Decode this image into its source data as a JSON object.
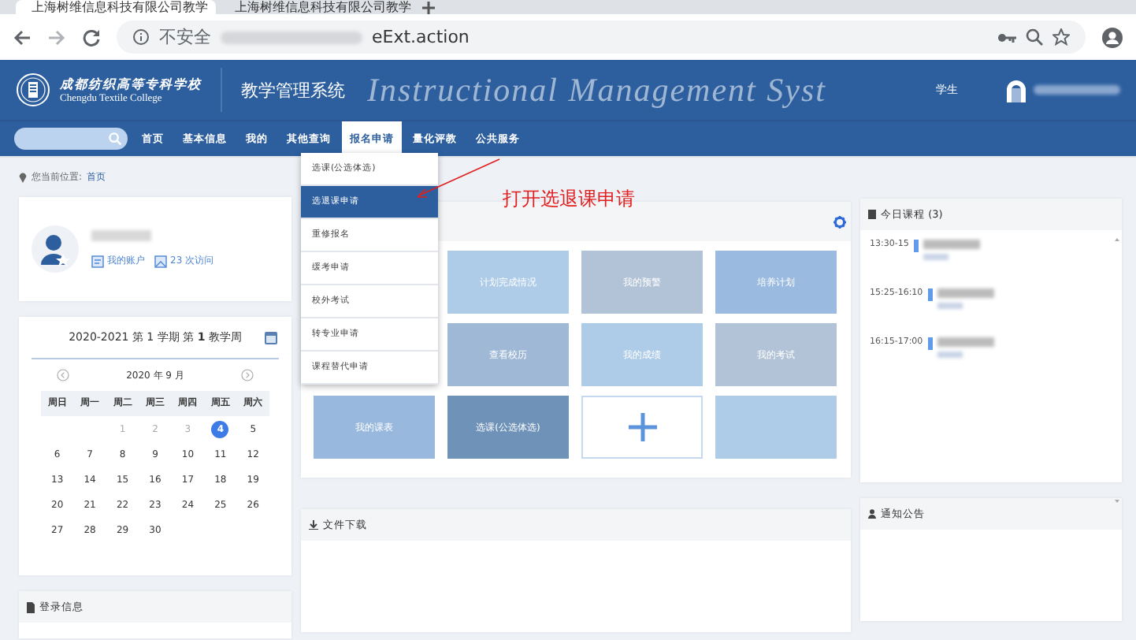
{
  "browser": {
    "tabs": [
      {
        "title": "上海树维信息科技有限公司教学",
        "selected": true
      },
      {
        "title": "上海树维信息科技有限公司教学",
        "selected": false
      }
    ],
    "address": {
      "security": "不安全",
      "url_end": "eExt.action"
    }
  },
  "header": {
    "school_name": "成都纺织高等专科学校",
    "school_name_en": "Chengdu Textile College",
    "system_title": "教学管理系统",
    "watermark": "Instructional Management Syst",
    "role": "学生"
  },
  "nav": {
    "items": [
      {
        "label": "首页",
        "selected": false
      },
      {
        "label": "基本信息",
        "selected": false
      },
      {
        "label": "我的",
        "selected": false
      },
      {
        "label": "其他查询",
        "selected": false
      },
      {
        "label": "报名申请",
        "selected": true
      },
      {
        "label": "量化评教",
        "selected": false
      },
      {
        "label": "公共服务",
        "selected": false
      }
    ]
  },
  "dropdown": {
    "items": [
      {
        "label": "选课(公选体选)",
        "selected": false
      },
      {
        "label": "选退课申请",
        "selected": true
      },
      {
        "label": "重修报名",
        "selected": false
      },
      {
        "label": "缓考申请",
        "selected": false
      },
      {
        "label": "校外考试",
        "selected": false
      },
      {
        "label": "转专业申请",
        "selected": false
      },
      {
        "label": "课程替代申请",
        "selected": false
      }
    ]
  },
  "annotation": {
    "text": "打开选退课申请"
  },
  "breadcrumb": {
    "label": "您当前位置:",
    "current": "首页"
  },
  "profile": {
    "links": [
      "我的账户",
      "23 次访问"
    ]
  },
  "calendar": {
    "term": "2020-2021 第 1 学期 第 **1** 教学周",
    "month": "2020 年 9 月",
    "weekdays": [
      "周日",
      "周一",
      "周二",
      "周三",
      "周四",
      "周五",
      "周六"
    ],
    "weeks": [
      {
        "days": [
          {
            "day": "1",
            "muted": true,
            "selected": false
          },
          {
            "day": "2",
            "muted": true,
            "selected": false
          },
          {
            "day": "3",
            "muted": true,
            "selected": false
          },
          {
            "day": "4",
            "muted": false,
            "selected": true
          },
          {
            "day": "5",
            "muted": false,
            "selected": false
          }
        ]
      },
      {
        "days": [
          {
            "day": "6",
            "muted": false,
            "selected": false
          },
          {
            "day": "7",
            "muted": false,
            "selected": false
          },
          {
            "day": "8",
            "muted": false,
            "selected": false
          },
          {
            "day": "9",
            "muted": false,
            "selected": false
          },
          {
            "day": "10",
            "muted": false,
            "selected": false
          },
          {
            "day": "11",
            "muted": false,
            "selected": false
          },
          {
            "day": "12",
            "muted": false,
            "selected": false
          }
        ]
      },
      {
        "days": [
          {
            "day": "13",
            "muted": false,
            "selected": false
          },
          {
            "day": "14",
            "muted": false,
            "selected": false
          },
          {
            "day": "15",
            "muted": false,
            "selected": false
          },
          {
            "day": "16",
            "muted": false,
            "selected": false
          },
          {
            "day": "17",
            "muted": false,
            "selected": false
          },
          {
            "day": "18",
            "muted": false,
            "selected": false
          },
          {
            "day": "19",
            "muted": false,
            "selected": false
          }
        ]
      },
      {
        "days": [
          {
            "day": "20",
            "muted": false,
            "selected": false
          },
          {
            "day": "21",
            "muted": false,
            "selected": false
          },
          {
            "day": "22",
            "muted": false,
            "selected": false
          },
          {
            "day": "23",
            "muted": false,
            "selected": false
          },
          {
            "day": "24",
            "muted": false,
            "selected": false
          },
          {
            "day": "25",
            "muted": false,
            "selected": false
          },
          {
            "day": "26",
            "muted": false,
            "selected": false
          }
        ]
      },
      {
        "days": [
          {
            "day": "27",
            "muted": false,
            "selected": false
          },
          {
            "day": "28",
            "muted": false,
            "selected": false
          },
          {
            "day": "29",
            "muted": false,
            "selected": false
          },
          {
            "day": "30",
            "muted": false,
            "selected": false
          }
        ]
      }
    ]
  },
  "login_info": {
    "title": "登录信息"
  },
  "tiles": [
    {
      "kind": "covered"
    },
    {
      "kind": "link",
      "label": "计划完成情况",
      "color": "#aecbe8"
    },
    {
      "kind": "link",
      "label": "我的预警",
      "color": "#b3c3d7"
    },
    {
      "kind": "link",
      "label": "培养计划",
      "color": "#9abbdf"
    },
    {
      "kind": "covered"
    },
    {
      "kind": "link",
      "label": "查看校历",
      "color": "#9fb8d6"
    },
    {
      "kind": "link",
      "label": "我的成绩",
      "color": "#aecbe8"
    },
    {
      "kind": "link",
      "label": "我的考试",
      "color": "#b3c3d7"
    },
    {
      "kind": "link",
      "label": "我的课表",
      "color": "#98b9dd"
    },
    {
      "kind": "link",
      "label": "选课(公选体选)",
      "color": "#6f92b9"
    },
    {
      "kind": "add"
    },
    {
      "kind": "blank",
      "color": "#aecbe8"
    }
  ],
  "files": {
    "title": "文件下载"
  },
  "today": {
    "title": "今日课程 (3)",
    "courses": [
      {
        "time": "13:30-15"
      },
      {
        "time": "15:25-16:10"
      },
      {
        "time": "16:15-17:00"
      }
    ]
  },
  "notices": {
    "title": "通知公告"
  }
}
